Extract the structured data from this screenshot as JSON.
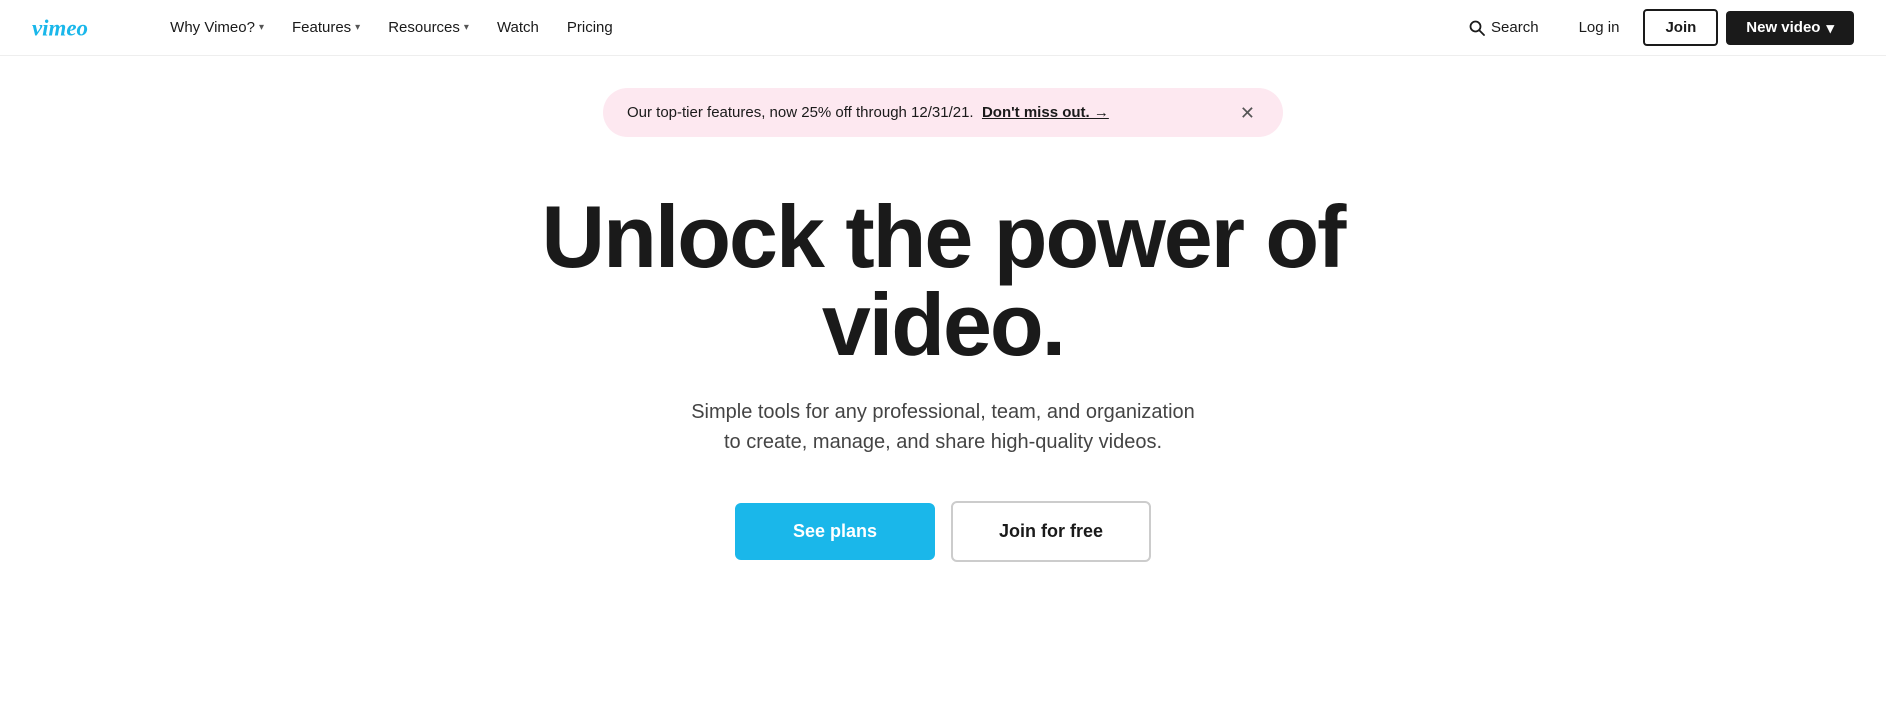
{
  "navbar": {
    "logo_alt": "Vimeo",
    "nav_items": [
      {
        "label": "Why Vimeo?",
        "has_dropdown": true
      },
      {
        "label": "Features",
        "has_dropdown": true
      },
      {
        "label": "Resources",
        "has_dropdown": true
      },
      {
        "label": "Watch",
        "has_dropdown": false
      },
      {
        "label": "Pricing",
        "has_dropdown": false
      }
    ],
    "search_label": "Search",
    "login_label": "Log in",
    "join_label": "Join",
    "new_video_label": "New video"
  },
  "banner": {
    "text": "Our top-tier features, now 25% off through 12/31/21.",
    "link_text": "Don't miss out. →",
    "close_aria": "Close banner"
  },
  "hero": {
    "title": "Unlock the power of video.",
    "subtitle": "Simple tools for any professional, team, and organization to create, manage, and share high-quality videos.",
    "btn_plans": "See plans",
    "btn_join": "Join for free"
  }
}
